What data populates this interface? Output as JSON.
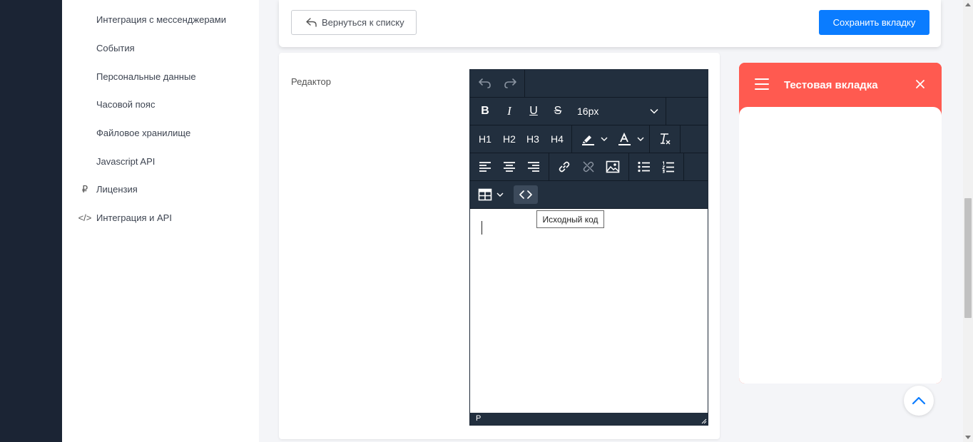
{
  "sidebar": {
    "items": [
      {
        "label": "Интеграция с мессенджерами",
        "icon": ""
      },
      {
        "label": "События",
        "icon": ""
      },
      {
        "label": "Персональные данные",
        "icon": ""
      },
      {
        "label": "Часовой пояс",
        "icon": ""
      },
      {
        "label": "Файловое хранилище",
        "icon": ""
      },
      {
        "label": "Javascript API",
        "icon": ""
      },
      {
        "label": "Лицензия",
        "icon": "ruble-icon",
        "glyph": "₽"
      },
      {
        "label": "Интеграция и API",
        "icon": "code-icon",
        "glyph": "</>"
      }
    ]
  },
  "toolbar": {
    "back_label": "Вернуться к списку",
    "save_label": "Сохранить вкладку"
  },
  "form": {
    "editor_label": "Редактор"
  },
  "editor": {
    "buttons": {
      "bold": "B",
      "italic": "I",
      "underline": "U",
      "strike": "S",
      "h1": "H1",
      "h2": "H2",
      "h3": "H3",
      "h4": "H4"
    },
    "font_size": "16px",
    "tooltip": "Исходный код",
    "status_path": "P",
    "content": ""
  },
  "preview": {
    "title": "Тестовая вкладка",
    "accent": "#ff5a50"
  },
  "colors": {
    "primary": "#0a7cff",
    "toolbar_bg": "#222f3e",
    "left_bar": "#1b2434"
  }
}
